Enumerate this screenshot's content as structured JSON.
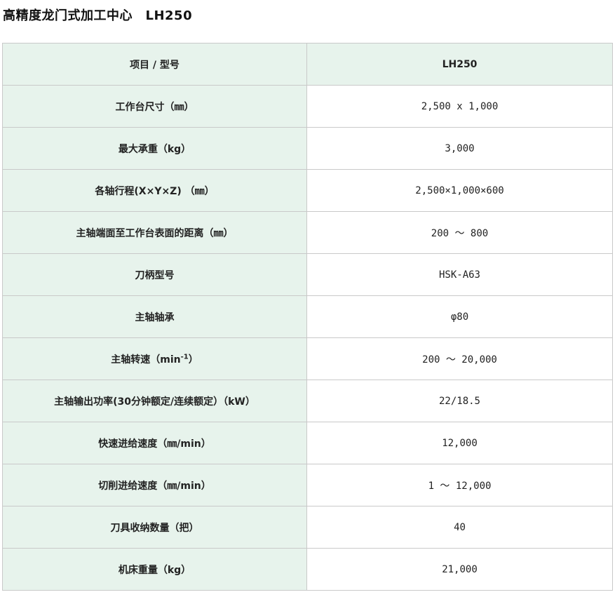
{
  "page": {
    "title": "高精度龙门式加工中心　LH250"
  },
  "table": {
    "header": {
      "label": "项目 / 型号",
      "value": "LH250"
    },
    "rows": [
      {
        "label": "工作台尺寸（㎜）",
        "value": "2,500 x 1,000"
      },
      {
        "label": "最大承重（kg）",
        "value": "3,000"
      },
      {
        "label": "各轴行程(X×Y×Z) （㎜）",
        "value": "2,500×1,000×600"
      },
      {
        "label": "主轴端面至工作台表面的距离（㎜）",
        "value": "200 ～ 800"
      },
      {
        "label": "刀柄型号",
        "value": "HSK-A63"
      },
      {
        "label": "主轴轴承",
        "value": "φ80"
      },
      {
        "label_pre": "主轴转速（min",
        "label_sup": "-1",
        "label_post": "）",
        "value": "200 ～ 20,000"
      },
      {
        "label": "主轴输出功率(30分钟额定/连续额定）（kW）",
        "value": "22/18.5"
      },
      {
        "label": "快速进给速度（㎜/min）",
        "value": "12,000"
      },
      {
        "label": "切削进给速度（㎜/min）",
        "value": "1 ～ 12,000"
      },
      {
        "label": "刀具收纳数量（把）",
        "value": "40"
      },
      {
        "label": "机床重量（kg）",
        "value": "21,000"
      }
    ]
  }
}
